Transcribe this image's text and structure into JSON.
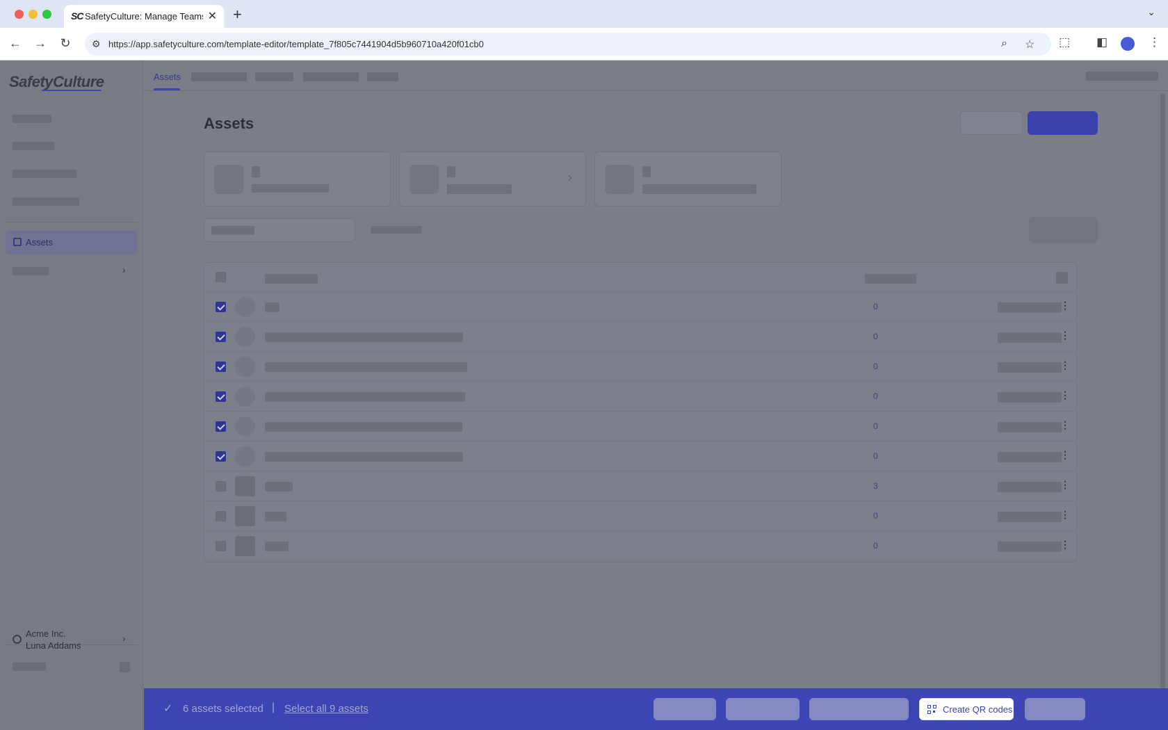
{
  "browser": {
    "tab_title": "SafetyCulture: Manage Teams and...",
    "favicon_text": "SC",
    "url": "https://app.safetyculture.com/template-editor/template_7f805c7441904d5b960710a420f01cb0",
    "icons": [
      "back-icon",
      "forward-icon",
      "reload-icon",
      "site-info-icon",
      "zoom-icon",
      "star-icon",
      "extensions-icon",
      "side-panel-icon",
      "profile-icon",
      "more-icon"
    ]
  },
  "sidebar": {
    "logo": "SafetyCulture",
    "active_item": "Assets",
    "org": {
      "name": "Acme Inc.",
      "user": "Luna Addams"
    }
  },
  "topnav": {
    "active_tab": "Assets"
  },
  "page": {
    "title": "Assets"
  },
  "table": {
    "rows": [
      {
        "checked": true,
        "count": "0",
        "thumb": "circle"
      },
      {
        "checked": true,
        "count": "0",
        "thumb": "circle"
      },
      {
        "checked": true,
        "count": "0",
        "thumb": "circle"
      },
      {
        "checked": true,
        "count": "0",
        "thumb": "circle"
      },
      {
        "checked": true,
        "count": "0",
        "thumb": "circle"
      },
      {
        "checked": true,
        "count": "0",
        "thumb": "circle"
      },
      {
        "checked": false,
        "count": "3",
        "thumb": "square"
      },
      {
        "checked": false,
        "count": "0",
        "thumb": "square"
      },
      {
        "checked": false,
        "count": "0",
        "thumb": "square"
      }
    ]
  },
  "action_bar": {
    "selected_text": "6 assets selected",
    "separator": "|",
    "select_all_link": "Select all 9 assets",
    "qr_button": "Create QR codes"
  },
  "colors": {
    "brand": "#3d44b4",
    "overlay": "#7b7e87"
  }
}
